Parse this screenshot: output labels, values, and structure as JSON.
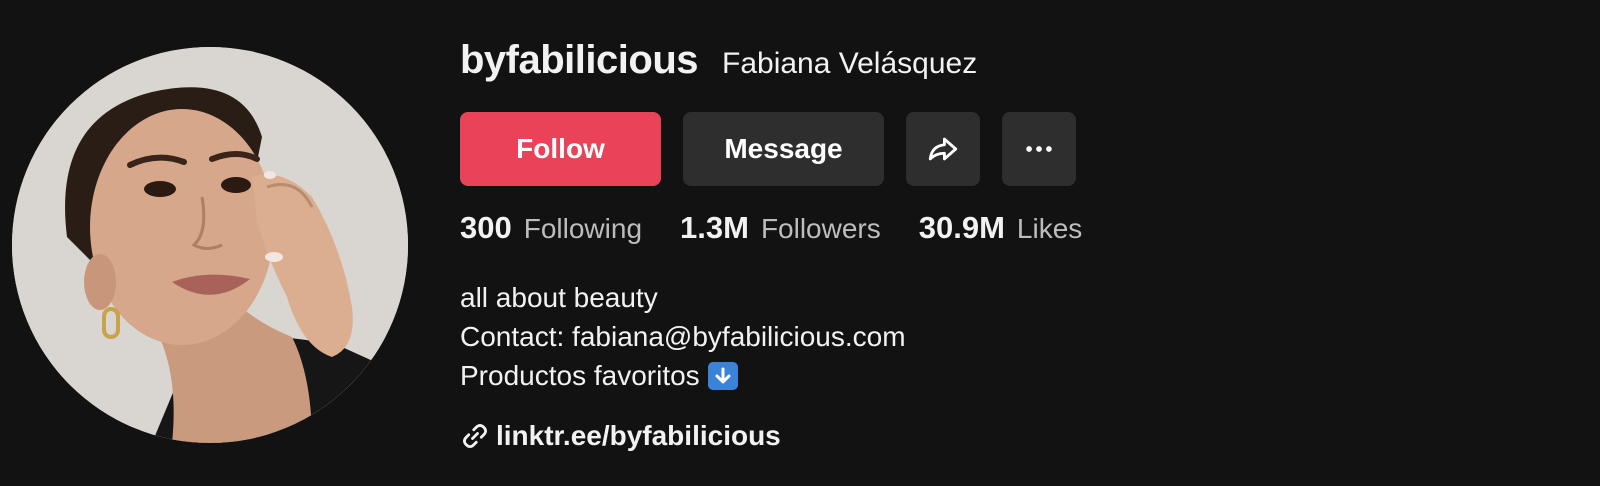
{
  "profile": {
    "username": "byfabilicious",
    "nickname": "Fabiana Velásquez",
    "avatar_icon": "profile-photo"
  },
  "actions": {
    "follow_label": "Follow",
    "message_label": "Message",
    "share_icon": "share-arrow-icon",
    "more_icon": "more-horizontal-icon"
  },
  "stats": [
    {
      "value": "300",
      "label": "Following"
    },
    {
      "value": "1.3M",
      "label": "Followers"
    },
    {
      "value": "30.9M",
      "label": "Likes"
    }
  ],
  "bio": {
    "line1": "all about beauty",
    "line2": "Contact: fabiana@byfabilicious.com",
    "line3": "Productos favoritos",
    "line3_emoji_icon": "down-arrow-emoji-icon"
  },
  "link": {
    "icon": "link-icon",
    "text": "linktr.ee/byfabilicious"
  },
  "colors": {
    "background": "#121212",
    "follow_button": "#ea4359",
    "secondary_button": "#2e2e2e",
    "muted_text": "#bdbdbd"
  }
}
